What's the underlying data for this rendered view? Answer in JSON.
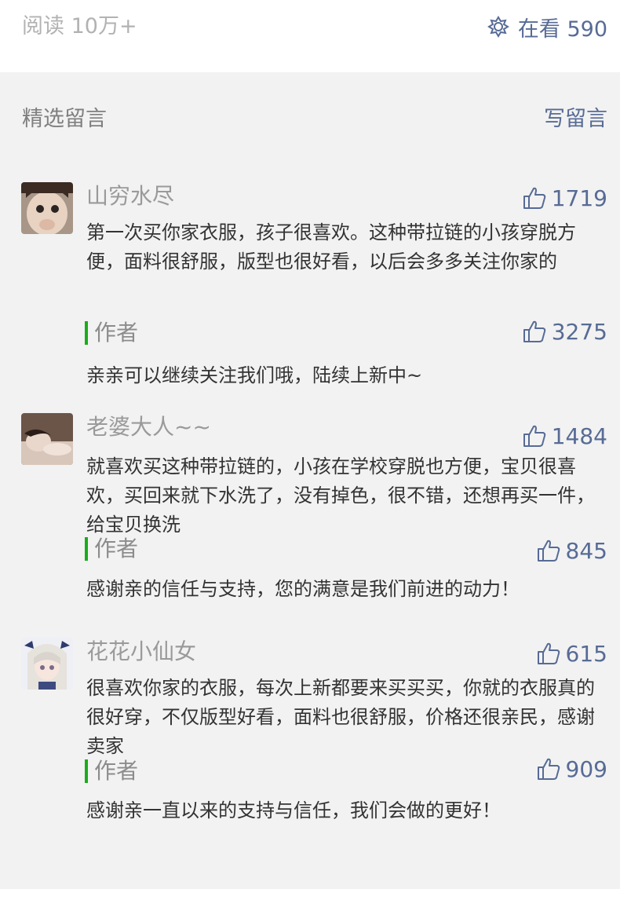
{
  "header": {
    "read_count": "阅读 10万+",
    "watching_label": "在看 590"
  },
  "section": {
    "title": "精选留言",
    "write_label": "写留言"
  },
  "comments": [
    {
      "nickname": "山穷水尽",
      "likes": "1719",
      "content": "第一次买你家衣服，孩子很喜欢。这种带拉链的小孩穿脱方便，面料很舒服，版型也很好看，以后会多多关注你家的",
      "reply_label": "作者",
      "reply_likes": "3275",
      "reply_text": "亲亲可以继续关注我们哦，陆续上新中~"
    },
    {
      "nickname": "老婆大人~~",
      "likes": "1484",
      "content": "就喜欢买这种带拉链的，小孩在学校穿脱也方便，宝贝很喜欢，买回来就下水洗了，没有掉色，很不错，还想再买一件，给宝贝换洗",
      "reply_label": "作者",
      "reply_likes": "845",
      "reply_text": "感谢亲的信任与支持，您的满意是我们前进的动力！"
    },
    {
      "nickname": "花花小仙女",
      "likes": "615",
      "content": "很喜欢你家的衣服，每次上新都要来买买买，你就的衣服真的很好穿，不仅版型好看，面料也很舒服，价格还很亲民，感谢卖家",
      "reply_label": "作者",
      "reply_likes": "909",
      "reply_text": "感谢亲一直以来的支持与信任，我们会做的更好！"
    }
  ],
  "colors": {
    "link_blue": "#576b95",
    "author_green": "#1aad19",
    "text": "#333333",
    "muted": "#9a9a9a"
  },
  "icons": {
    "watching": "wow-flower-icon",
    "like": "thumbs-up-icon"
  }
}
